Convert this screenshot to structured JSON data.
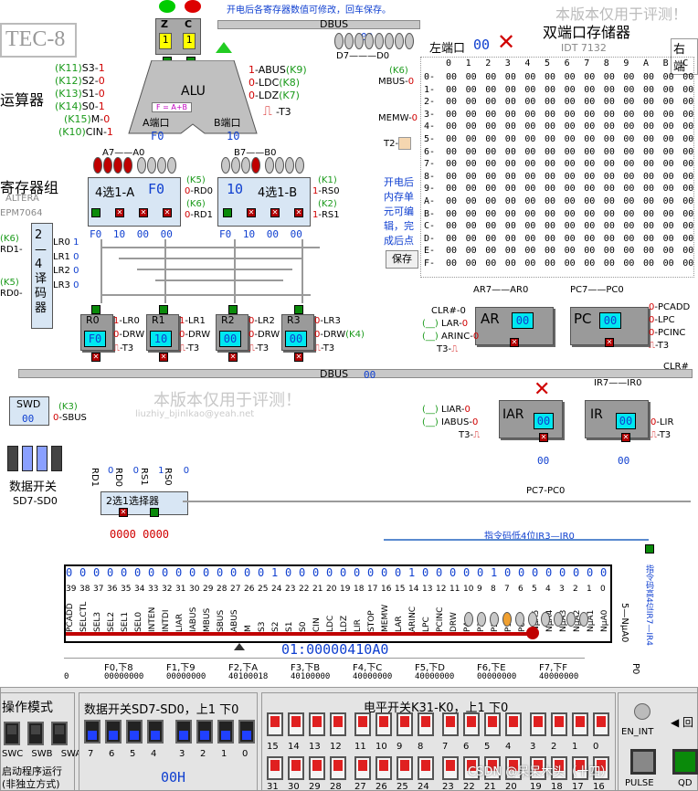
{
  "header": {
    "title_tec8": "TEC-8",
    "hint": "开电后各寄存器数值可修改，回车保存。",
    "watermark_top": "本版本仅用于评测！",
    "dbus_top": "DBUS",
    "dbus_bottom": "DBUS",
    "d7d0": "D7———D0",
    "ram_title": "双端口存储器",
    "ram_model": "IDT 7132",
    "left_port": "左端口",
    "left_port_val": "00",
    "right_port": "右端",
    "alu_label": "运算器",
    "reg_group": "寄存器组",
    "reg_chip1": "ALTERA",
    "reg_chip2": "EPM7064"
  },
  "alu": {
    "z": "Z",
    "c": "C",
    "z_val": "1",
    "c_val": "1",
    "z_disp": "1",
    "c_disp": "1",
    "out_val": "00",
    "title": "ALU",
    "func": "F = A+B",
    "port_a": "A端口",
    "port_b": "B端口",
    "port_a_val": "F0",
    "port_b_val": "10",
    "left_signals": [
      {
        "k": "(K11)",
        "s": "S3-",
        "v": "1"
      },
      {
        "k": "(K12)",
        "s": "S2-",
        "v": "0"
      },
      {
        "k": "(K13)",
        "s": "S1-",
        "v": "0"
      },
      {
        "k": "(K14)",
        "s": "S0-",
        "v": "1"
      },
      {
        "k": "(K15)",
        "s": "M-",
        "v": "0"
      },
      {
        "k": "(K10)",
        "s": "CIN-",
        "v": "1"
      }
    ],
    "right_signals": [
      {
        "v": "1",
        "s": "-ABUS",
        "k": "(K9)"
      },
      {
        "v": "0",
        "s": "-LDC",
        "k": "(K8)"
      },
      {
        "v": "0",
        "s": "-LDZ",
        "k": "(K7)"
      }
    ],
    "t3": "-T3"
  },
  "mux": {
    "a_title": "4选1-A",
    "a_val": "F0",
    "b_title": "4选1-B",
    "b_val": "10",
    "a7a0": "A7——A0",
    "b7b0": "B7——B0",
    "rd0": "RD0",
    "rd1": "RD1",
    "rs0": "RS0",
    "rs1": "RS1",
    "k5": "(K5)",
    "k6": "(K6)",
    "k1": "(K1)",
    "k2": "(K2)",
    "rd0v": "0",
    "rd1v": "0",
    "rs0v": "1",
    "rs1v": "1",
    "a_inputs": [
      "F0",
      "10",
      "00",
      "00"
    ],
    "b_inputs": [
      "F0",
      "10",
      "00",
      "00"
    ]
  },
  "decoder": {
    "title": "2—4译码器",
    "lr": [
      "LR0",
      "LR1",
      "LR2",
      "LR3"
    ],
    "lr_vals": [
      "1",
      "0",
      "0",
      "0"
    ],
    "rd1": "RD1-",
    "rd0": "RD0-",
    "k6": "(K6)",
    "k5": "(K5)"
  },
  "regs": [
    {
      "name": "R0",
      "val": "F0",
      "lr": "-LR0",
      "v": "1"
    },
    {
      "name": "R1",
      "val": "10",
      "lr": "-LR1",
      "v": "1"
    },
    {
      "name": "R2",
      "val": "00",
      "lr": "-LR2",
      "v": "0"
    },
    {
      "name": "R3",
      "val": "00",
      "lr": "-LR3",
      "v": "0"
    }
  ],
  "drw": "-DRW",
  "drw_v": "0",
  "t3": "-T3",
  "k4": "(K4)",
  "swd": {
    "name": "SWD",
    "val": "00",
    "sbus": "-SBUS",
    "k3": "(K3)",
    "sbus_v": "0"
  },
  "data_switch": {
    "title": "数据开关",
    "sub": "SD7-SD0"
  },
  "watermark_mid": "本版本仅用于评测！",
  "watermark_mail": "liuzhiy_bjinlkao@yeah.net",
  "selector": {
    "title": "2选1选择器",
    "labels": [
      "RD1",
      "RD0",
      "RS1",
      "RS0"
    ],
    "vals": [
      "0",
      "0",
      "1",
      "0"
    ],
    "out": "0000 0000"
  },
  "ram": {
    "cols": [
      "0",
      "1",
      "2",
      "3",
      "4",
      "5",
      "6",
      "7",
      "8",
      "9",
      "A",
      "B",
      "C"
    ],
    "rows": [
      "0-",
      "1-",
      "2-",
      "3-",
      "4-",
      "5-",
      "6-",
      "7-",
      "8-",
      "9-",
      "A-",
      "B-",
      "C-",
      "D-",
      "E-",
      "F-"
    ],
    "cell": "00",
    "mbus": "MBUS",
    "memw": "MEMW",
    "k6": "(K6)",
    "t2": "T2-",
    "mbus_v": "0",
    "memw_v": "0",
    "edit_hint": "开电后内存单元可编辑，完成后点",
    "save_btn": "保存"
  },
  "ar": {
    "name": "AR",
    "val": "00",
    "clr": "CLR#-",
    "lar": "LAR",
    "arinc": "ARINC",
    "t3": "T3-",
    "ar_range": "AR7——AR0",
    "k": "(__)"
  },
  "pc": {
    "name": "PC",
    "val": "00",
    "pcadd": "-PCADD",
    "lpc": "-LPC",
    "pcinc": "-PCINC",
    "t3": "-T3",
    "clr": "CLR#",
    "range": "PC7——PC0",
    "vals": [
      "0",
      "0",
      "0"
    ]
  },
  "iar": {
    "name": "IAR",
    "val": "00",
    "liar": "LIAR",
    "iabus": "IABUS",
    "t3": "T3-",
    "k": "(__)"
  },
  "ir": {
    "name": "IR",
    "val": "00",
    "lir": "-LIR",
    "t3": "-T3",
    "range": "IR7——IR0",
    "out": "00"
  },
  "pc_bus": "PC7-PC0",
  "ir_low": "指令码低4位IR3—IR0",
  "ir_high": "指令码高4位IR7—IR4",
  "np": "5—NμA0",
  "po": "P0",
  "microcode": {
    "bits": [
      "0",
      "0",
      "0",
      "0",
      "0",
      "0",
      "0",
      "0",
      "0",
      "0",
      "0",
      "0",
      "0",
      "0",
      "0",
      "1",
      "0",
      "0",
      "0",
      "0",
      "0",
      "0",
      "0",
      "0",
      "0",
      "1",
      "0",
      "0",
      "0",
      "0",
      "0",
      "1",
      "0",
      "0",
      "0",
      "0",
      "0",
      "0",
      "0",
      "0"
    ],
    "index": [
      "39",
      "38",
      "37",
      "36",
      "35",
      "34",
      "33",
      "32",
      "31",
      "30",
      "29",
      "28",
      "27",
      "26",
      "25",
      "24",
      "23",
      "22",
      "21",
      "20",
      "19",
      "18",
      "17",
      "16",
      "15",
      "14",
      "13",
      "12",
      "11",
      "10",
      "9",
      "8",
      "7",
      "6",
      "5",
      "4",
      "3",
      "2",
      "1",
      "0"
    ],
    "names": [
      "PCADD",
      "SELCTL",
      "SEL3",
      "SEL2",
      "SEL1",
      "SEL0",
      "INTEN",
      "INTDI",
      "LIAR",
      "IABUS",
      "MBUS",
      "SBUS",
      "ABUS",
      "M",
      "S3",
      "S2",
      "S1",
      "S0",
      "CIN",
      "LDC",
      "LDZ",
      "LIR",
      "STOP",
      "MEMW",
      "LAR",
      "ARINC",
      "LPC",
      "PCINC",
      "DRW",
      "P4",
      "P3",
      "P2",
      "P1",
      "P0",
      "NμA5",
      "NμA4",
      "NμA3",
      "NμA2",
      "NμA1",
      "NμA0"
    ],
    "address": "01:00000410A0",
    "tabs": [
      "F0,下8",
      "F1,下9",
      "F2,下A",
      "F3,下B",
      "F4,下C",
      "F5,下D",
      "F6,下E",
      "F7,下F"
    ],
    "row": [
      "0",
      "00000000",
      "00000000",
      "40100018",
      "40100000",
      "40000000",
      "40000000",
      "00000000",
      "40000000"
    ]
  },
  "bottom": {
    "mode_title": "操作模式",
    "mode_sw": [
      "SWC",
      "SWB",
      "SWA"
    ],
    "mode_desc": "启动程序运行(非独立方式)",
    "data_title": "数据开关SD7-SD0，上1 下0",
    "data_nums": [
      "7",
      "6",
      "5",
      "4",
      "3",
      "2",
      "1",
      "0"
    ],
    "data_hex": "00H",
    "level_title": "电平开关K31-K0，上1 下0",
    "level_top": [
      "15",
      "14",
      "13",
      "12",
      "11",
      "10",
      "9",
      "8",
      "7",
      "6",
      "5",
      "4",
      "3",
      "2",
      "1",
      "0"
    ],
    "level_bottom": [
      "31",
      "30",
      "29",
      "28",
      "27",
      "26",
      "25",
      "24",
      "23",
      "22",
      "21",
      "20",
      "19",
      "18",
      "17",
      "16"
    ],
    "en_int": "EN_INT",
    "back": "◀ 回",
    "pulse": "PULSE",
    "qd": "QD",
    "csdn": "CSDN @呆呆木头（十四）"
  },
  "colors": {
    "lcd": "#00e8f0",
    "green": "#0a8a0a",
    "red": "#c00000",
    "gray": "#9a9a9a",
    "bg": "#ffffff"
  }
}
